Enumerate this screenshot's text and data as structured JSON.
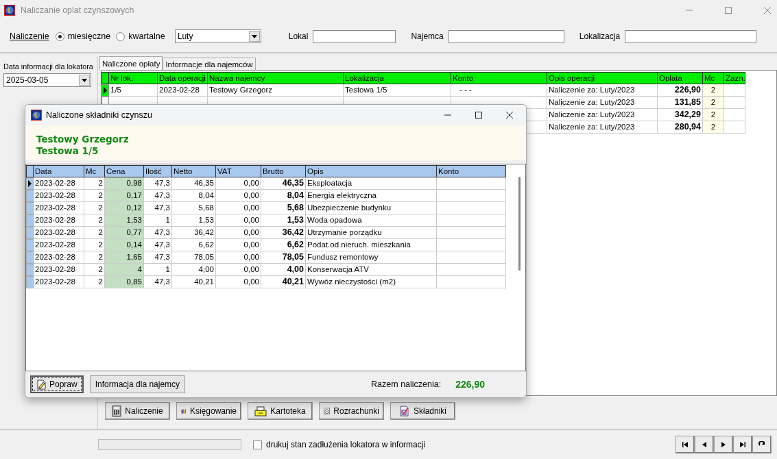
{
  "window": {
    "title": "Naliczanie oplat czynszowych"
  },
  "filter": {
    "label": "Naliczenie",
    "options": [
      {
        "label": "miesięczne",
        "selected": true
      },
      {
        "label": "kwartalne",
        "selected": false
      }
    ],
    "period": "Luty",
    "fields": [
      {
        "label": "Lokal"
      },
      {
        "label": "Najemca"
      },
      {
        "label": "Lokalizacja"
      }
    ]
  },
  "sidebar": {
    "label": "Data informacji dla lokatora",
    "date": "2025-03-05"
  },
  "tabs": [
    {
      "label": "Naliczone opłaty",
      "selected": true
    },
    {
      "label": "Informacje dla najemców",
      "selected": false
    }
  ],
  "table": {
    "columns": [
      "Nr lok.",
      "Data operacji",
      "Nazwa najemcy",
      "Lokalizacja",
      "Konto",
      "Opis operacji",
      "Opłata",
      "Mc",
      "Zazn."
    ],
    "rows": [
      {
        "selected": true,
        "cells": [
          "1/5",
          "2023-02-28",
          "Testowy Grzegorz",
          "Testowa 1/5",
          "- - -",
          "Naliczenie za: Luty/2023",
          "226,90",
          "2"
        ]
      },
      {
        "selected": false,
        "cells": [
          "Naliczenie za: Luty/2023",
          "131,85",
          "2"
        ]
      },
      {
        "cells": [
          "Naliczenie za: Luty/2023",
          "342,29",
          "2"
        ]
      },
      {
        "cells": [
          "Naliczenie za: Luty/2023",
          "280,94",
          "2"
        ]
      }
    ]
  },
  "toolbar": [
    {
      "label": "Naliczenie",
      "kind": "calculator"
    },
    {
      "label": "Księgowanie",
      "kind": "books"
    },
    {
      "label": "Kartoteka",
      "kind": "box"
    },
    {
      "label": "Rozrachunki",
      "kind": "clock"
    },
    {
      "label": "Składniki",
      "kind": "checklist"
    }
  ],
  "footer": {
    "progress": {
      "level": 0
    },
    "checkbox": {
      "label": "drukuj stan zadłużenia lokatora w informacji",
      "checked": false
    }
  },
  "dialog": {
    "title": "Naliczone składniki czynszu",
    "tenant": "Testowy Grzegorz",
    "location": "Testowa 1/5",
    "table": {
      "columns": [
        "Data",
        "Mc",
        "Cena",
        "Ilość",
        "Netto",
        "VAT",
        "Brutto",
        "Opis",
        "Konto"
      ],
      "rows": [
        {
          "selected": true,
          "cells": [
            "2023-02-28",
            "2",
            "0,98",
            "47,3",
            "46,35",
            "0,00",
            "46,35",
            "Eksploatacja"
          ]
        },
        {
          "selected": false,
          "cells": [
            "2023-02-28",
            "2",
            "0,17",
            "47,3",
            "8,04",
            "0,00",
            "8,04",
            "Energia elektryczna"
          ]
        },
        {
          "selected": false,
          "cells": [
            "2023-02-28",
            "2",
            "0,12",
            "47,3",
            "5,68",
            "0,00",
            "5,68",
            "Ubezpieczenie budynku"
          ]
        },
        {
          "selected": false,
          "cells": [
            "2023-02-28",
            "2",
            "1,53",
            "1",
            "1,53",
            "0,00",
            "1,53",
            "Woda opadowa"
          ]
        },
        {
          "selected": false,
          "cells": [
            "2023-02-28",
            "2",
            "0,77",
            "47,3",
            "36,42",
            "0,00",
            "36,42",
            "Utrzymanie porządku"
          ]
        },
        {
          "selected": false,
          "cells": [
            "2023-02-28",
            "2",
            "0,14",
            "47,3",
            "6,62",
            "0,00",
            "6,62",
            "Podat.od nieruch. mieszkania"
          ]
        },
        {
          "selected": false,
          "cells": [
            "2023-02-28",
            "2",
            "1,65",
            "47,3",
            "78,05",
            "0,00",
            "78,05",
            "Fundusz remontowy"
          ]
        },
        {
          "selected": false,
          "cells": [
            "2023-02-28",
            "2",
            "4",
            "1",
            "4,00",
            "0,00",
            "4,00",
            "Konserwacja ATV"
          ]
        },
        {
          "selected": false,
          "cells": [
            "2023-02-28",
            "2",
            "0,85",
            "47,3",
            "40,21",
            "0,00",
            "40,21",
            "Wywóz nieczystości (m2)"
          ]
        }
      ]
    },
    "buttons": [
      {
        "label": "Popraw",
        "kind": "edit"
      },
      {
        "label": "Informacja dla najemcy",
        "kind": "plain"
      }
    ],
    "total_label": "Razem naliczenia:",
    "total": "226,90"
  }
}
